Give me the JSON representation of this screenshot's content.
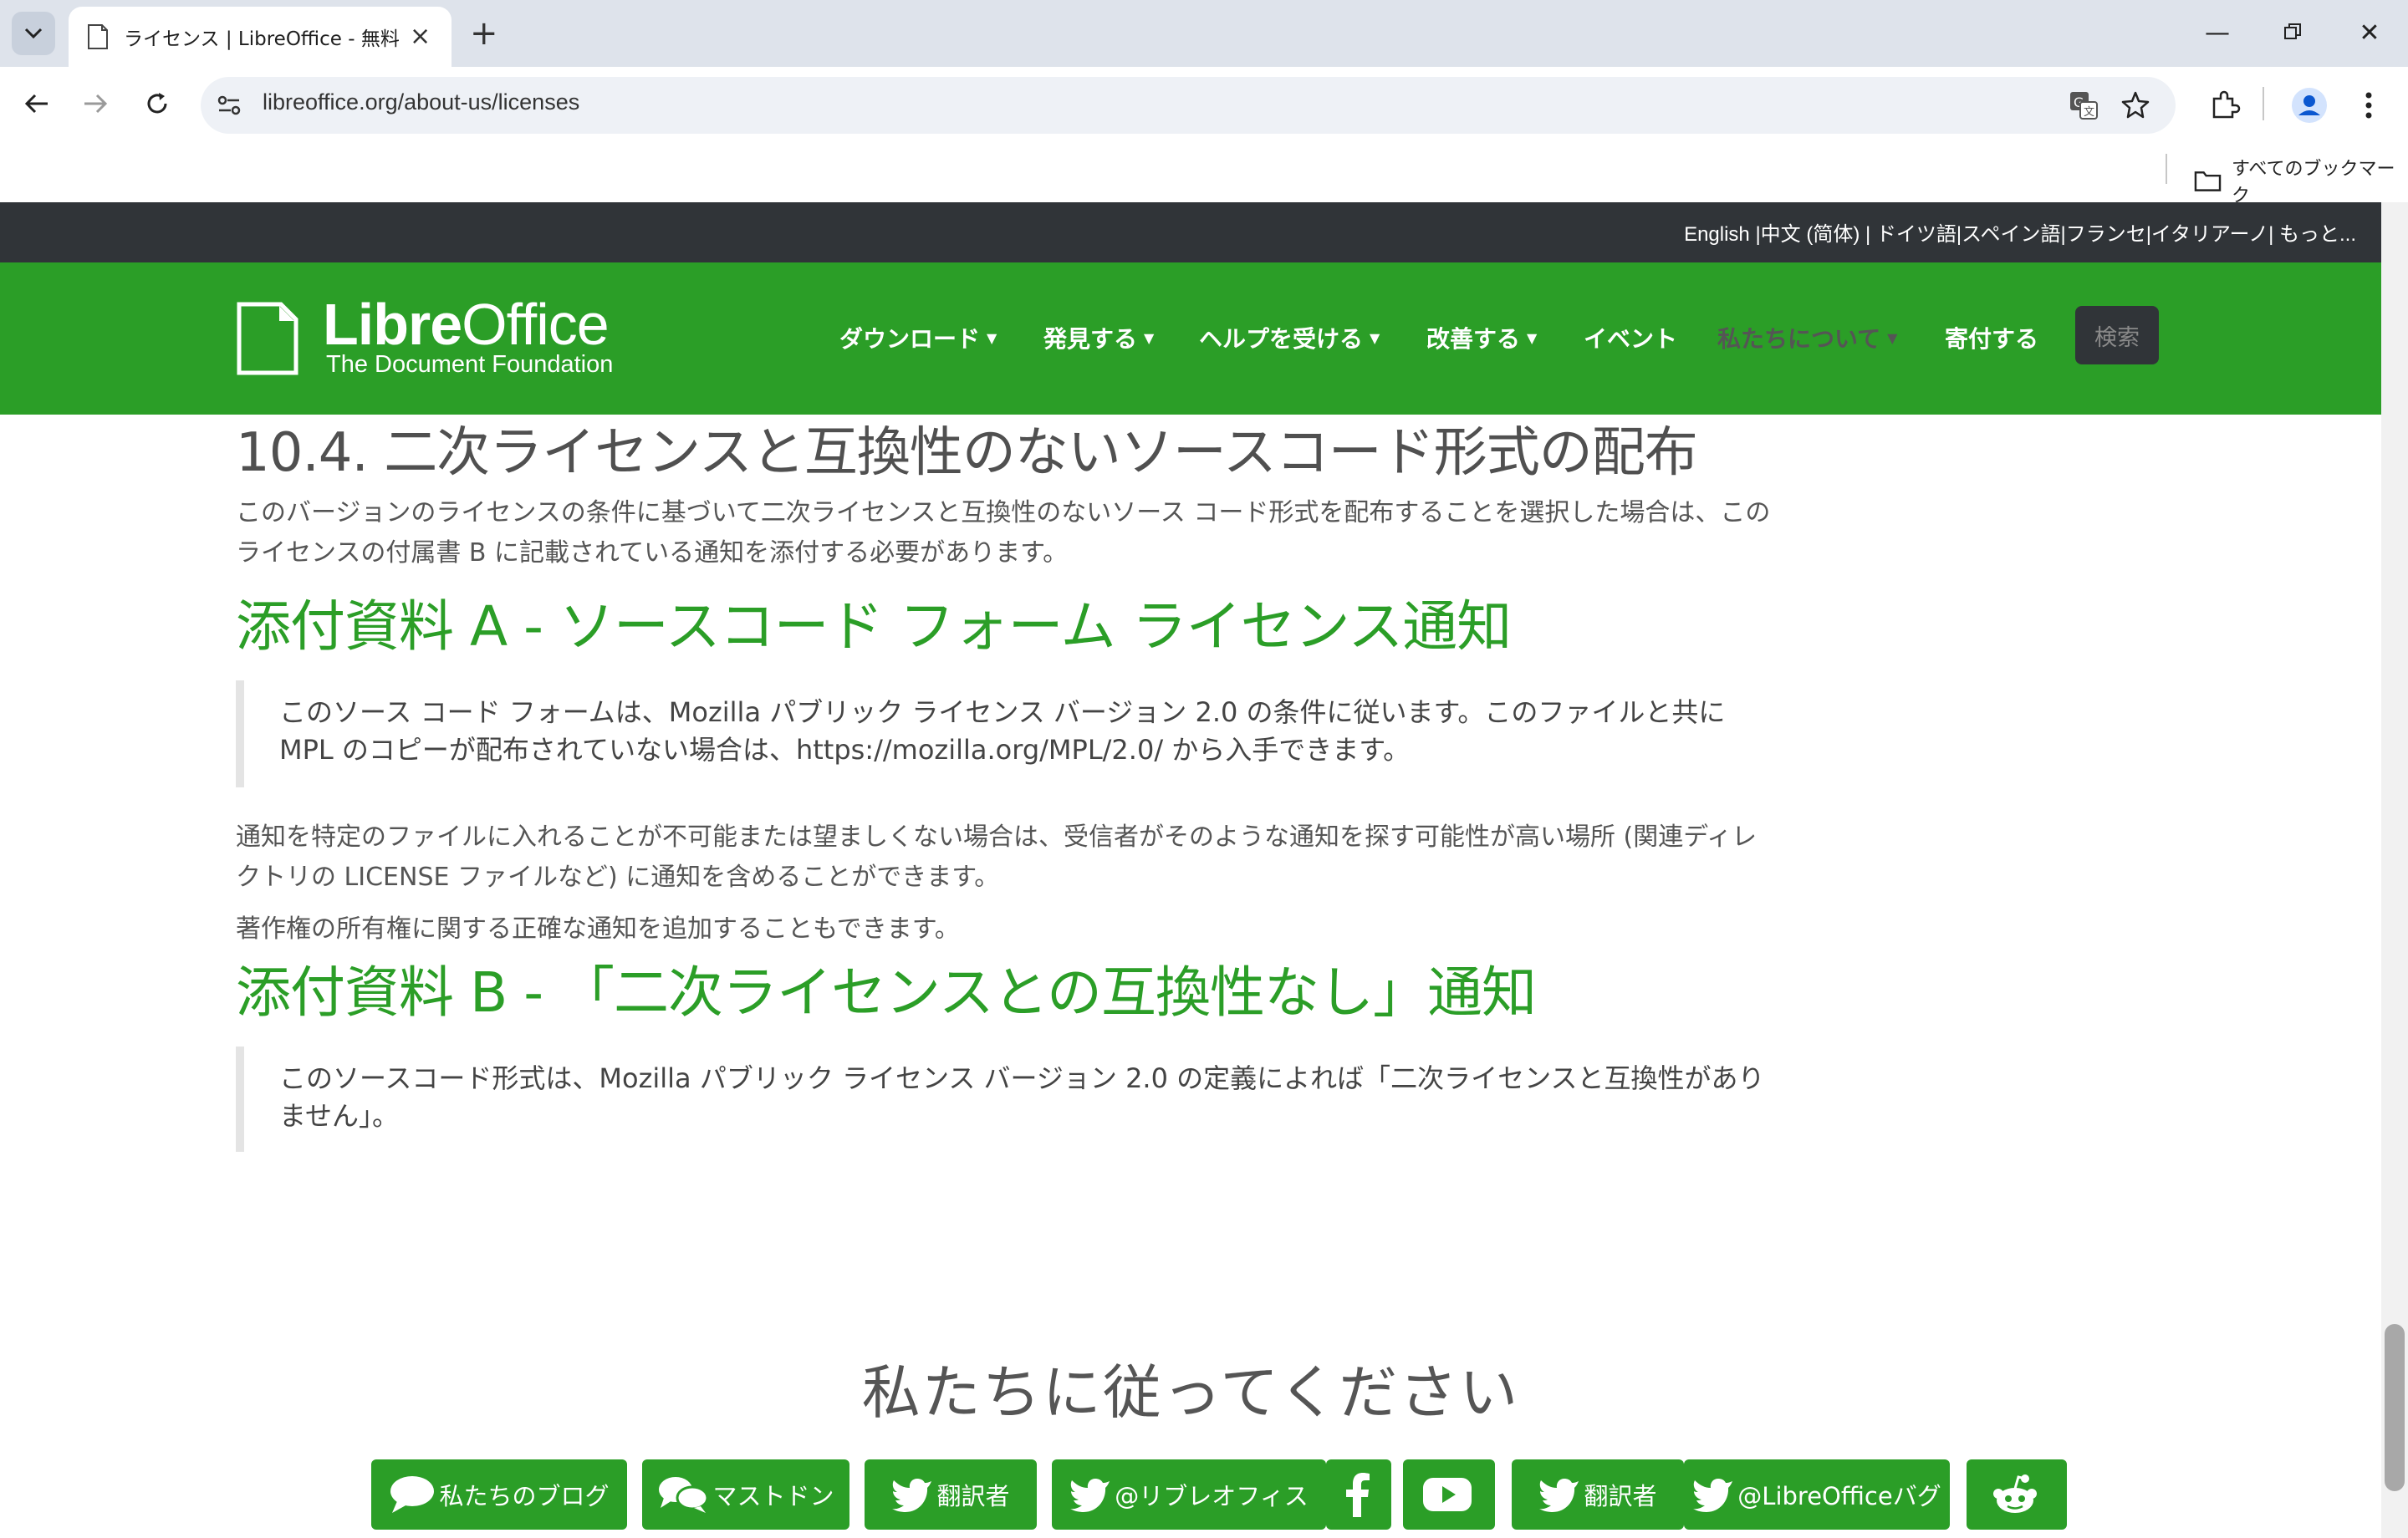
{
  "browser": {
    "tab_title": "ライセンス | LibreOffice - 無料のオフィススイート",
    "url": "libreoffice.org/about-us/licenses",
    "bookmarks_label": "すべてのブックマーク"
  },
  "page": {
    "language_bar": "English |中文 (简体) | ドイツ語|スペイン語|フランセ|イタリアーノ| もっと...",
    "logo": {
      "name_bold": "Libre",
      "name_light": "Office",
      "subtitle": "The Document Foundation"
    },
    "nav": [
      {
        "label": "ダウンロード",
        "dropdown": true
      },
      {
        "label": "発見する",
        "dropdown": true
      },
      {
        "label": "ヘルプを受ける",
        "dropdown": true
      },
      {
        "label": "改善する",
        "dropdown": true
      },
      {
        "label": "イベント",
        "dropdown": false
      },
      {
        "label": "私たちについて",
        "dropdown": true
      },
      {
        "label": "寄付する",
        "dropdown": false
      }
    ],
    "search_label": "検索",
    "section_heading": "10.4. 二次ライセンスと互換性のないソースコード形式の配布",
    "section_body": "このバージョンのライセンスの条件に基づいて二次ライセンスと互換性のないソース コード形式を配布することを選択した場合は、このライセンスの付属書 B に記載されている通知を添付する必要があります。",
    "exhibit_a_heading": "添付資料 A - ソースコード フォーム ライセンス通知",
    "exhibit_a_quote": "このソース コード フォームは、Mozilla パブリック ライセンス バージョン 2.0 の条件に従います。このファイルと共に MPL のコピーが配布されていない場合は、https://mozilla.org/MPL/2.0/ から入手できます。",
    "exhibit_a_p1": "通知を特定のファイルに入れることが不可能または望ましくない場合は、受信者がそのような通知を探す可能性が高い場所 (関連ディレクトリの LICENSE ファイルなど) に通知を含めることができます。",
    "exhibit_a_p2": "著作権の所有権に関する正確な通知を追加することもできます。",
    "exhibit_b_heading": "添付資料 B - 「二次ライセンスとの互換性なし」通知",
    "exhibit_b_quote": "このソースコード形式は、Mozilla パブリック ライセンス バージョン 2.0 の定義によれば「二次ライセンスと互換性がありません」。",
    "follow_heading": "私たちに従ってください",
    "social": [
      {
        "label": "私たちのブログ",
        "icon": "speech-bubble-icon"
      },
      {
        "label": "マストドン",
        "icon": "mastodon-bubbles-icon"
      },
      {
        "label": "翻訳者",
        "icon": "twitter-bird-icon"
      },
      {
        "label": "@リブレオフィス",
        "icon": "twitter-bird-icon"
      },
      {
        "label": "",
        "icon": "facebook-icon"
      },
      {
        "label": "",
        "icon": "youtube-icon"
      },
      {
        "label": "翻訳者",
        "icon": "twitter-bird-icon"
      },
      {
        "label": "@LibreOfficeバグ",
        "icon": "twitter-bird-icon"
      },
      {
        "label": "",
        "icon": "reddit-icon"
      }
    ]
  },
  "colors": {
    "brand_green": "#2b9e27",
    "dark_bar": "#303438",
    "chrome_bg": "#dee3eb"
  }
}
